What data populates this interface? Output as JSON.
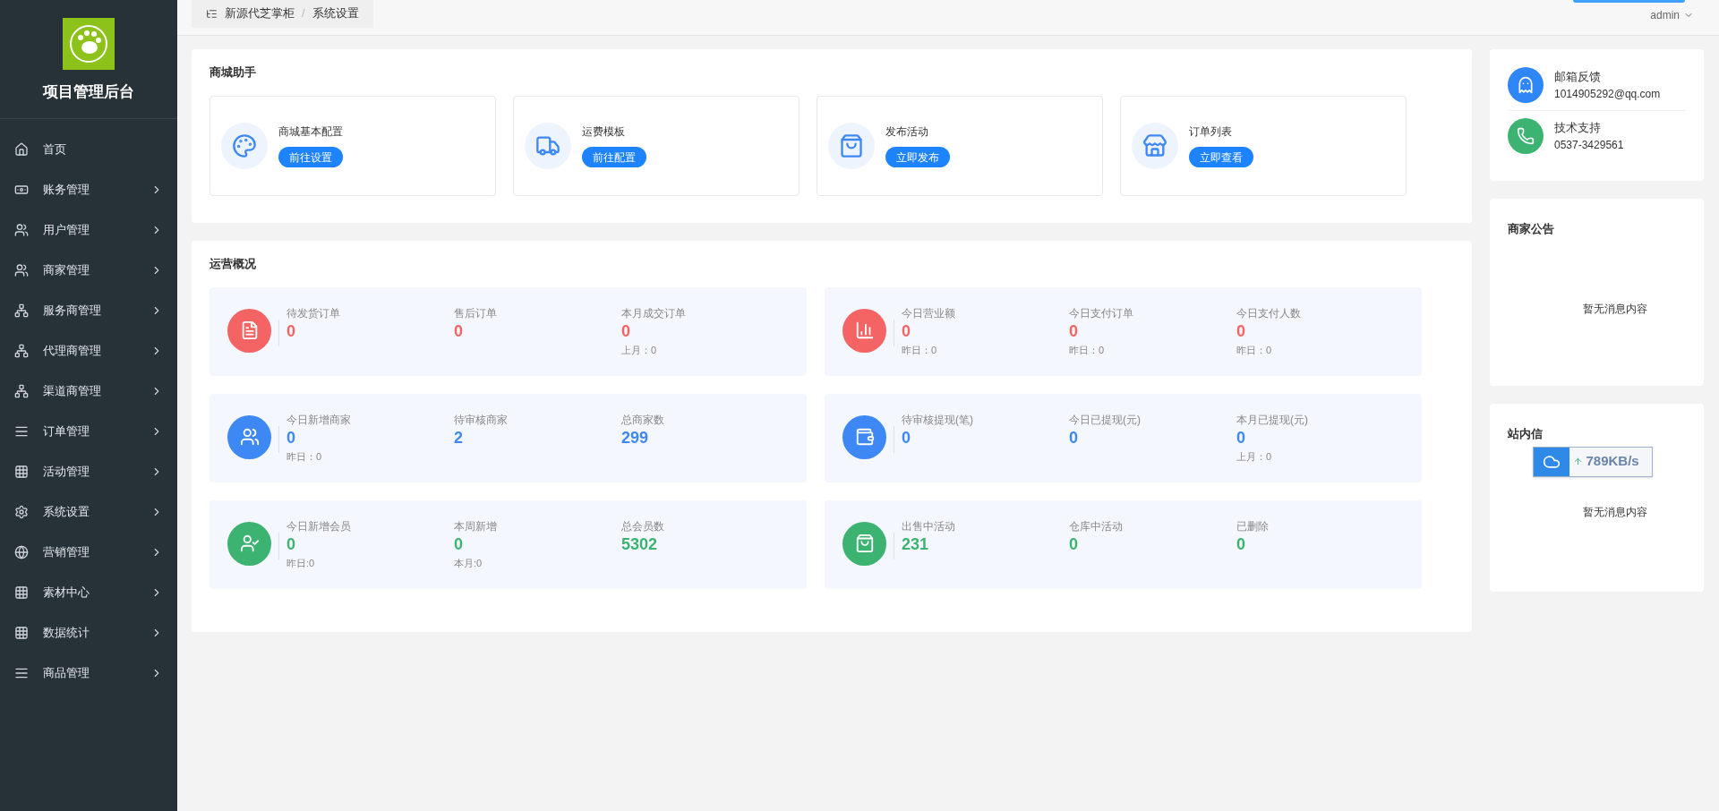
{
  "sidebar": {
    "title": "项目管理后台",
    "items": [
      {
        "label": "首页",
        "expandable": false
      },
      {
        "label": "账务管理",
        "expandable": true
      },
      {
        "label": "用户管理",
        "expandable": true
      },
      {
        "label": "商家管理",
        "expandable": true
      },
      {
        "label": "服务商管理",
        "expandable": true
      },
      {
        "label": "代理商管理",
        "expandable": true
      },
      {
        "label": "渠道商管理",
        "expandable": true
      },
      {
        "label": "订单管理",
        "expandable": true
      },
      {
        "label": "活动管理",
        "expandable": true
      },
      {
        "label": "系统设置",
        "expandable": true
      },
      {
        "label": "营销管理",
        "expandable": true
      },
      {
        "label": "素材中心",
        "expandable": true
      },
      {
        "label": "数据统计",
        "expandable": true
      },
      {
        "label": "商品管理",
        "expandable": true
      }
    ]
  },
  "breadcrumb": [
    "新源代芝掌柜",
    "系统设置"
  ],
  "breadcrumb_separator": "/",
  "user_menu": {
    "label": "admin"
  },
  "helper": {
    "title": "商城助手",
    "cards": [
      {
        "title": "商城基本配置",
        "button": "前往设置"
      },
      {
        "title": "运费模板",
        "button": "前往配置"
      },
      {
        "title": "发布活动",
        "button": "立即发布"
      },
      {
        "title": "订单列表",
        "button": "立即查看"
      }
    ]
  },
  "overview": {
    "title": "运营概况",
    "blocks": [
      {
        "color": "#f56464",
        "items": [
          {
            "label": "待发货订单",
            "value": "0"
          },
          {
            "label": "售后订单",
            "value": "0"
          },
          {
            "label": "本月成交订单",
            "value": "0",
            "sub": "上月：0"
          }
        ]
      },
      {
        "color": "#f56464",
        "items": [
          {
            "label": "今日营业额",
            "value": "0",
            "sub": "昨日：0"
          },
          {
            "label": "今日支付订单",
            "value": "0",
            "sub": "昨日：0"
          },
          {
            "label": "今日支付人数",
            "value": "0",
            "sub": "昨日：0"
          }
        ]
      },
      {
        "color": "#3d88f5",
        "items": [
          {
            "label": "今日新增商家",
            "value": "0",
            "sub": "昨日：0"
          },
          {
            "label": "待审核商家",
            "value": "2"
          },
          {
            "label": "总商家数",
            "value": "299"
          }
        ]
      },
      {
        "color": "#3d88f5",
        "items": [
          {
            "label": "待审核提现(笔)",
            "value": "0"
          },
          {
            "label": "今日已提现(元)",
            "value": "0"
          },
          {
            "label": "本月已提现(元)",
            "value": "0",
            "sub": "上月：0"
          }
        ]
      },
      {
        "color": "#3cb371",
        "items": [
          {
            "label": "今日新增会员",
            "value": "0",
            "sub": "昨日:0"
          },
          {
            "label": "本周新增",
            "value": "0",
            "sub": "本月:0"
          },
          {
            "label": "总会员数",
            "value": "5302"
          }
        ]
      },
      {
        "color": "#3cb371",
        "items": [
          {
            "label": "出售中活动",
            "value": "231"
          },
          {
            "label": "仓库中活动",
            "value": "0"
          },
          {
            "label": "已删除",
            "value": "0"
          }
        ]
      }
    ]
  },
  "contacts": [
    {
      "title": "邮箱反馈",
      "detail": "1014905292@qq.com",
      "color": "#2f86f6"
    },
    {
      "title": "技术支持",
      "detail": "0537-3429561",
      "color": "#3cb371"
    }
  ],
  "notices": {
    "title": "商家公告",
    "empty": "暂无消息内容"
  },
  "messages": {
    "title": "站内信",
    "empty": "暂无消息内容"
  },
  "speed_widget": {
    "reading": "789KB/s"
  }
}
